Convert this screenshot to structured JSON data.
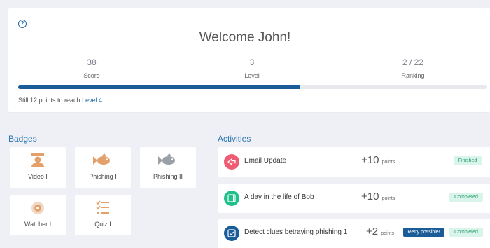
{
  "welcome": {
    "title": "Welcome John!",
    "stats": [
      {
        "value": "38",
        "label": "Score"
      },
      {
        "value": "3",
        "label": "Level"
      },
      {
        "value": "2 / 22",
        "label": "Ranking"
      }
    ],
    "progress_fraction": 0.6,
    "hint_prefix": "Still 12 points to reach ",
    "hint_level": "Level 4"
  },
  "badges": {
    "title": "Badges",
    "items": [
      {
        "label": "Video I",
        "icon": "graduate-icon"
      },
      {
        "label": "Phishing I",
        "icon": "fish-icon"
      },
      {
        "label": "Phishing II",
        "icon": "fish-gray-icon"
      },
      {
        "label": "Watcher I",
        "icon": "eye-icon"
      },
      {
        "label": "Quiz I",
        "icon": "checklist-icon"
      }
    ]
  },
  "activities": {
    "title": "Activities",
    "items": [
      {
        "name": "Email Update",
        "points": "+10",
        "points_unit": "points",
        "status": "Finished",
        "icon": "share-icon",
        "icon_color": "#ef5b72"
      },
      {
        "name": "A day in the life of Bob",
        "points": "+10",
        "points_unit": "points",
        "status": "Completed",
        "icon": "film-icon",
        "icon_color": "#20c08a"
      },
      {
        "name": "Detect clues betraying phishing 1",
        "points": "+2",
        "points_unit": "points",
        "retry": "Retry possible!",
        "status": "Completed",
        "icon": "checkbox-icon",
        "icon_color": "#1a5c98"
      }
    ]
  },
  "colors": {
    "accent": "#1a5c98",
    "background": "#eef0f5",
    "badge_gold": "#e3a06b"
  }
}
